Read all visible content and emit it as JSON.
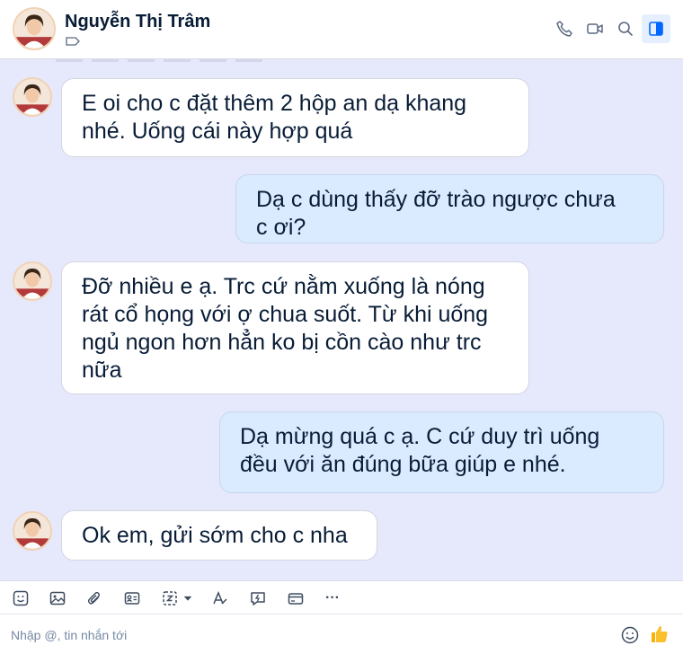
{
  "header": {
    "contact_name": "Nguyễn Thị Trâm",
    "icons": [
      "phone-icon",
      "video-call-icon",
      "search-icon",
      "sidebar-toggle-icon"
    ]
  },
  "messages": [
    {
      "direction": "in",
      "text_lines": [
        "E oi cho c đặt thêm 2 hộp an dạ khang",
        "nhé. Uống cái này hợp quá"
      ]
    },
    {
      "direction": "out",
      "text_lines": [
        "Dạ c dùng thấy đỡ trào ngược chưa",
        "c ơi?"
      ]
    },
    {
      "direction": "in",
      "text_lines": [
        "Đỡ nhiều e ạ. Trc cứ nằm xuống là nóng",
        "rát cổ họng với ợ chua suốt. Từ khi uống",
        "ngủ ngon hơn hẳn ko bị cồn cào như trc",
        "nữa"
      ]
    },
    {
      "direction": "out",
      "text_lines": [
        "Dạ mừng quá c ạ. C cứ duy trì uống",
        "đều với ăn đúng bữa giúp e nhé."
      ]
    },
    {
      "direction": "in",
      "text_lines": [
        "Ok em, gửi sớm cho c nha"
      ]
    }
  ],
  "toolbar": {
    "icons": [
      "sticker-icon",
      "image-icon",
      "attachment-icon",
      "contact-card-icon",
      "screenshot-icon",
      "dropdown-arrow-icon",
      "text-format-icon",
      "quick-message-icon",
      "payment-card-icon",
      "more-icon"
    ],
    "more_label": "···"
  },
  "composer": {
    "placeholder": "Nhập @, tin nhắn tới"
  },
  "colors": {
    "chat_background": "#e6e8fb",
    "incoming_bubble": "#ffffff",
    "outgoing_bubble": "#dbebff",
    "text": "#081c36",
    "accent": "#0068ff"
  }
}
